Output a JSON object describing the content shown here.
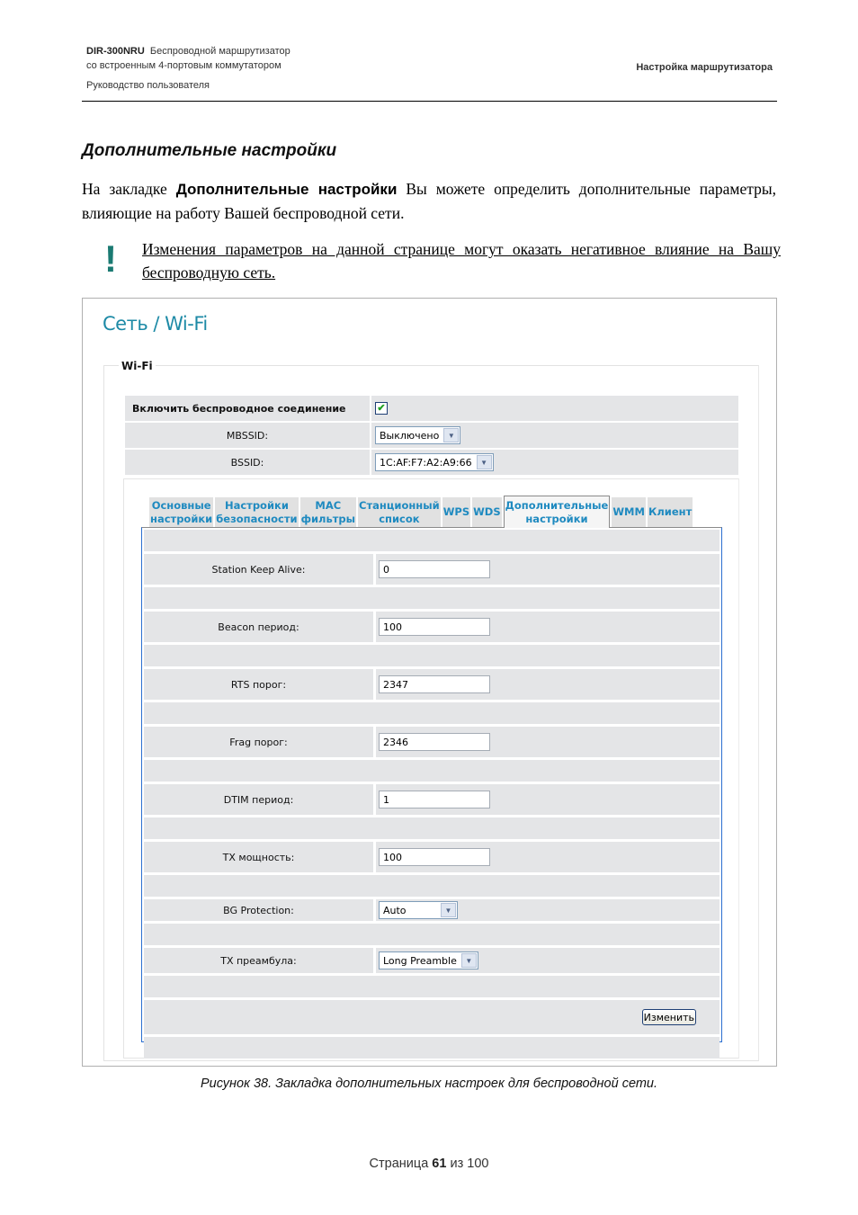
{
  "header": {
    "model": "DIR-300NRU",
    "product_line1": "Беспроводной  маршрутизатор",
    "product_line2": "со встроенным 4-портовым коммутатором",
    "doc_type": "Руководство пользователя",
    "chapter": "Настройка маршрутизатора"
  },
  "section": {
    "title": "Дополнительные настройки",
    "intro_prefix": "На закладке ",
    "intro_bold": "Дополнительные настройки",
    "intro_suffix": " Вы можете определить дополнительные параметры, влияющие на работу Вашей беспроводной сети.",
    "warning_mark": "!",
    "warning_text": "Изменения параметров на данной странице могут оказать негативное влияние на Вашу беспроводную сеть."
  },
  "screenshot": {
    "page_title": "Сеть / Wi-Fi",
    "fieldset_legend": "Wi-Fi",
    "enable_label": "Включить беспроводное соединение",
    "enable_checked": true,
    "enable_check_glyph": "✔",
    "mbssid_label": "MBSSID:",
    "mbssid_value": "Выключено",
    "bssid_label": "BSSID:",
    "bssid_value": "1C:AF:F7:A2:A9:66",
    "dropdown_arrow": "▼",
    "tabs": [
      {
        "label": "Основные\nнастройки",
        "active": false
      },
      {
        "label": "Настройки\nбезопасности",
        "active": false
      },
      {
        "label": "MAC\nфильтры",
        "active": false
      },
      {
        "label": "Станционный\nсписок",
        "active": false
      },
      {
        "label": "WPS",
        "active": false
      },
      {
        "label": "WDS",
        "active": false
      },
      {
        "label": "Дополнительные\nнастройки",
        "active": true
      },
      {
        "label": "WMM",
        "active": false
      },
      {
        "label": "Клиент",
        "active": false
      }
    ],
    "fields": {
      "station_keep_alive": {
        "label": "Station Keep Alive:",
        "value": "0"
      },
      "beacon_period": {
        "label": "Beacon период:",
        "value": "100"
      },
      "rts_threshold": {
        "label": "RTS порог:",
        "value": "2347"
      },
      "frag_threshold": {
        "label": "Frag порог:",
        "value": "2346"
      },
      "dtim_period": {
        "label": "DTIM период:",
        "value": "1"
      },
      "tx_power": {
        "label": "TX мощность:",
        "value": "100"
      },
      "bg_protection": {
        "label": "BG Protection:",
        "value": "Auto"
      },
      "tx_preamble": {
        "label": "TX преамбула:",
        "value": "Long Preamble"
      }
    },
    "apply_button": "Изменить"
  },
  "caption": "Рисунок 38. Закладка дополнительных настроек для беспроводной сети.",
  "footer": {
    "prefix": "Страница ",
    "page": "61",
    "middle": " из ",
    "total": "100"
  }
}
